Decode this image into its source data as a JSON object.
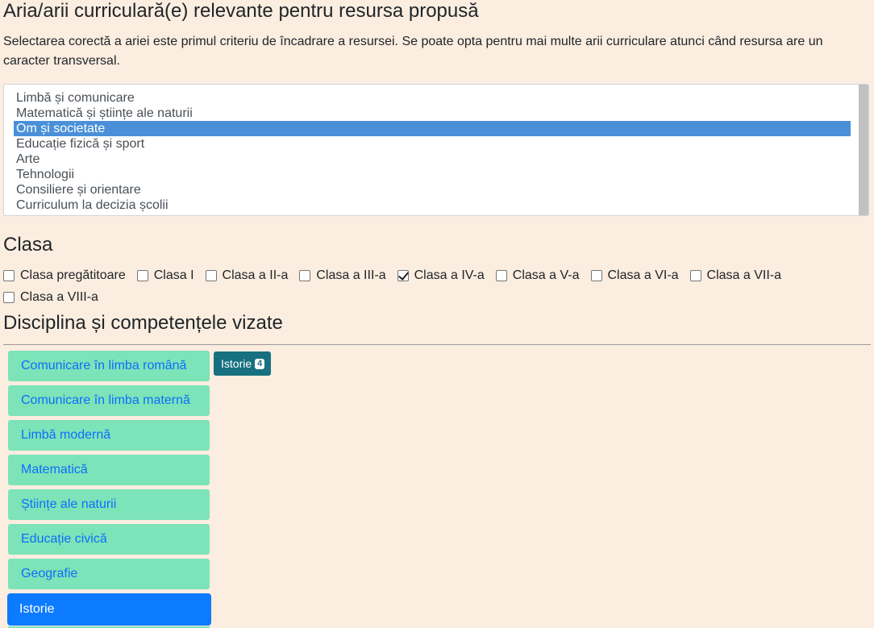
{
  "arie": {
    "title": "Aria/arii curriculară(e) relevante pentru resursa propusă",
    "help": "Selectarea corectă a ariei este primul criteriu de încadrare a resursei. Se poate opta pentru mai multe arii curriculare atunci când resursa are un caracter transversal.",
    "options": [
      {
        "label": "Limbă și comunicare",
        "selected": false
      },
      {
        "label": "Matematică și științe ale naturii",
        "selected": false
      },
      {
        "label": "Om și societate",
        "selected": true
      },
      {
        "label": "Educație fizică și sport",
        "selected": false
      },
      {
        "label": "Arte",
        "selected": false
      },
      {
        "label": "Tehnologii",
        "selected": false
      },
      {
        "label": "Consiliere și orientare",
        "selected": false
      },
      {
        "label": "Curriculum la decizia școlii",
        "selected": false
      }
    ]
  },
  "clasa": {
    "title": "Clasa",
    "options": [
      {
        "label": "Clasa pregătitoare",
        "checked": false
      },
      {
        "label": "Clasa I",
        "checked": false
      },
      {
        "label": "Clasa a II-a",
        "checked": false
      },
      {
        "label": "Clasa a III-a",
        "checked": false
      },
      {
        "label": "Clasa a IV-a",
        "checked": true
      },
      {
        "label": "Clasa a V-a",
        "checked": false
      },
      {
        "label": "Clasa a VI-a",
        "checked": false
      },
      {
        "label": "Clasa a VII-a",
        "checked": false
      },
      {
        "label": "Clasa a VIII-a",
        "checked": false
      }
    ]
  },
  "disciplina": {
    "title": "Disciplina și competențele vizate",
    "items": [
      {
        "label": "Comunicare în limba română",
        "active": false
      },
      {
        "label": "Comunicare în limba maternă",
        "active": false
      },
      {
        "label": "Limbă modernă",
        "active": false
      },
      {
        "label": "Matematică",
        "active": false
      },
      {
        "label": "Științe ale naturii",
        "active": false
      },
      {
        "label": "Educație civică",
        "active": false
      },
      {
        "label": "Geografie",
        "active": false
      },
      {
        "label": "Istorie",
        "active": true
      }
    ],
    "selected_tag": {
      "label": "Istorie",
      "count": "4"
    }
  },
  "colors": {
    "background": "#fbede0",
    "list_selected": "#4a90d9",
    "discipline_bg": "#7de3b8",
    "discipline_active": "#0d7bff",
    "tag_bg": "#17707f"
  }
}
